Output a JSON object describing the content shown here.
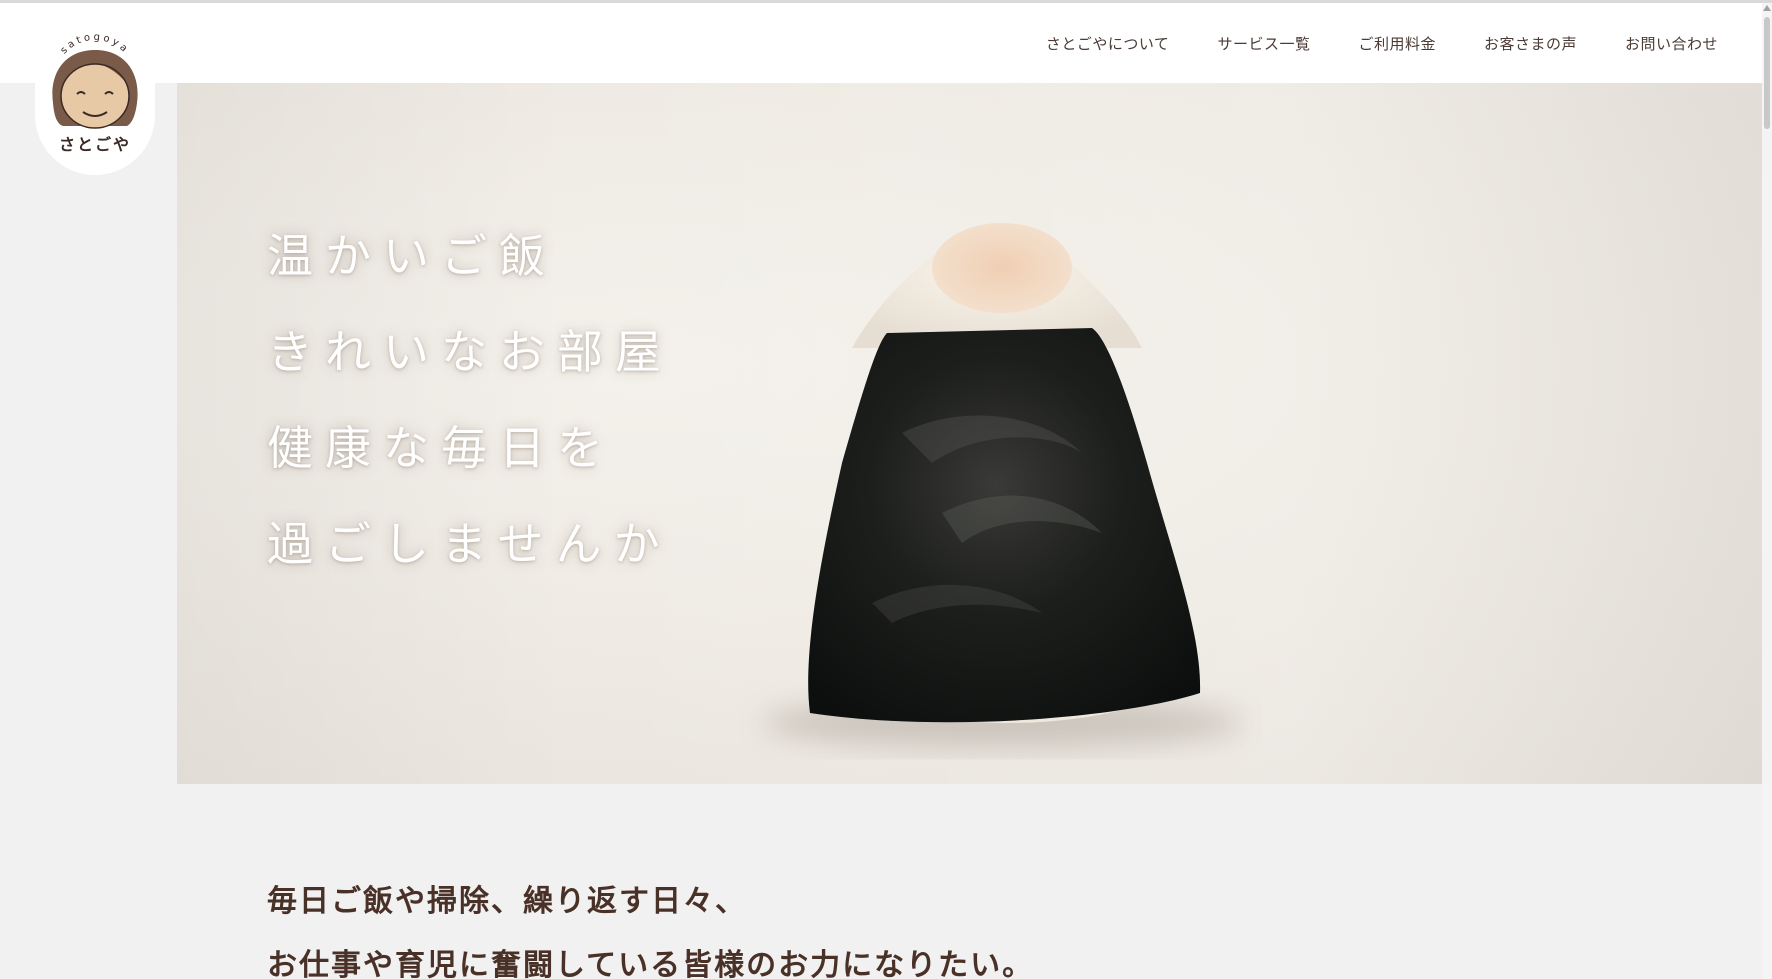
{
  "brand": {
    "logo_arc_text": "satogoya",
    "logo_text": "さとごや"
  },
  "nav": {
    "items": [
      "さとごやについて",
      "サービス一覧",
      "ご利用料金",
      "お客さまの声",
      "お問い合わせ"
    ]
  },
  "hero": {
    "lines": [
      "温かいご飯",
      "きれいなお部屋",
      "健康な毎日を",
      "過ごしませんか"
    ]
  },
  "intro": {
    "lines": [
      "毎日ご飯や掃除、繰り返す日々、",
      "お仕事や育児に奮闘している皆様のお力になりたい。"
    ]
  },
  "colors": {
    "text_brown": "#4a3128",
    "header_bg": "#ffffff",
    "page_bg": "#f1f1f1"
  }
}
